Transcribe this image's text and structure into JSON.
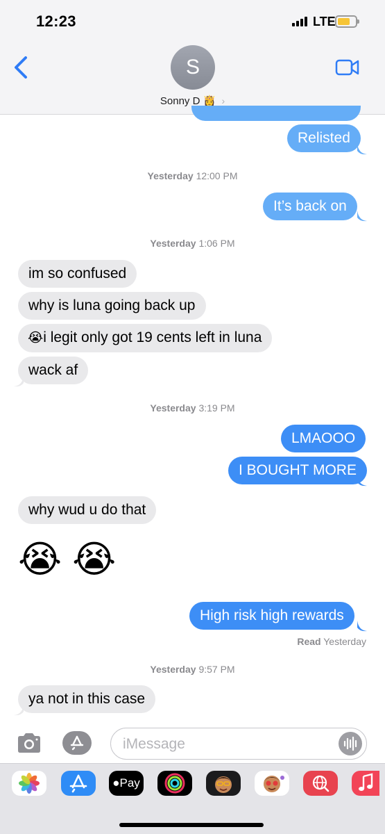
{
  "status_bar": {
    "time": "12:23",
    "network": "LTE"
  },
  "header": {
    "avatar_initial": "S",
    "contact_name": "Sonny D",
    "contact_emoji": "👸",
    "chevron": "›",
    "back_icon": "chevron-left-icon",
    "video_icon": "video-camera-icon"
  },
  "messages": {
    "m_relisted": "Relisted",
    "ts1": {
      "day": "Yesterday",
      "time": "12:00 PM"
    },
    "m_back_on": "It’s back on",
    "ts2": {
      "day": "Yesterday",
      "time": "1:06 PM"
    },
    "m_confused": "im so confused",
    "m_luna_up": "why is luna going back up",
    "m_legit_emoji": "😭",
    "m_legit": "i legit only got 19 cents left in luna",
    "m_wack": "wack af",
    "ts3": {
      "day": "Yesterday",
      "time": "3:19 PM"
    },
    "m_lmao": "LMAOOO",
    "m_bought": "I BOUGHT MORE",
    "m_why": "why wud u do that",
    "m_big_emoji": "😭 😭",
    "m_high_risk": "High risk high rewards",
    "read_label": "Read",
    "read_time": "Yesterday",
    "ts4": {
      "day": "Yesterday",
      "time": "9:57 PM"
    },
    "m_not_case": "ya not in this case"
  },
  "input": {
    "placeholder": "iMessage"
  },
  "app_drawer": {
    "apple_pay_label": "Pay",
    "apps": [
      "photos-icon",
      "app-store-icon",
      "apple-pay-icon",
      "activity-icon",
      "memoji-icon",
      "memoji-stickers-icon",
      "web-search-icon",
      "music-icon"
    ]
  },
  "colors": {
    "sent_bubble": "#3d8ef6",
    "received_bubble": "#e9e9eb",
    "accent": "#2f7cf6"
  }
}
